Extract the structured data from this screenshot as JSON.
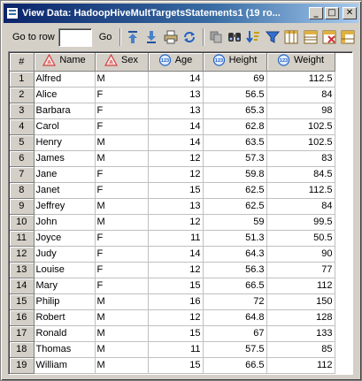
{
  "window": {
    "title": "View Data: HadoopHiveMultTargetsStatements1 (19 ro...",
    "buttons": [
      "_",
      "□",
      "✕"
    ]
  },
  "toolbar": {
    "goto_label": "Go to row",
    "goto_value": "",
    "go_label": "Go",
    "icons": [
      "move-top-icon",
      "move-bottom-icon",
      "print-icon",
      "refresh-icon",
      "copy-icon",
      "find-icon",
      "sort-icon",
      "filter-icon",
      "columns-icon",
      "view-icon",
      "properties-icon",
      "grid-options-icon"
    ]
  },
  "table": {
    "columns": [
      {
        "label": "#",
        "type": "index"
      },
      {
        "label": "Name",
        "type": "char"
      },
      {
        "label": "Sex",
        "type": "char"
      },
      {
        "label": "Age",
        "type": "num"
      },
      {
        "label": "Height",
        "type": "num"
      },
      {
        "label": "Weight",
        "type": "num"
      }
    ],
    "rows": [
      [
        "1",
        "Alfred",
        "M",
        "14",
        "69",
        "112.5"
      ],
      [
        "2",
        "Alice",
        "F",
        "13",
        "56.5",
        "84"
      ],
      [
        "3",
        "Barbara",
        "F",
        "13",
        "65.3",
        "98"
      ],
      [
        "4",
        "Carol",
        "F",
        "14",
        "62.8",
        "102.5"
      ],
      [
        "5",
        "Henry",
        "M",
        "14",
        "63.5",
        "102.5"
      ],
      [
        "6",
        "James",
        "M",
        "12",
        "57.3",
        "83"
      ],
      [
        "7",
        "Jane",
        "F",
        "12",
        "59.8",
        "84.5"
      ],
      [
        "8",
        "Janet",
        "F",
        "15",
        "62.5",
        "112.5"
      ],
      [
        "9",
        "Jeffrey",
        "M",
        "13",
        "62.5",
        "84"
      ],
      [
        "10",
        "John",
        "M",
        "12",
        "59",
        "99.5"
      ],
      [
        "11",
        "Joyce",
        "F",
        "11",
        "51.3",
        "50.5"
      ],
      [
        "12",
        "Judy",
        "F",
        "14",
        "64.3",
        "90"
      ],
      [
        "13",
        "Louise",
        "F",
        "12",
        "56.3",
        "77"
      ],
      [
        "14",
        "Mary",
        "F",
        "15",
        "66.5",
        "112"
      ],
      [
        "15",
        "Philip",
        "M",
        "16",
        "72",
        "150"
      ],
      [
        "16",
        "Robert",
        "M",
        "12",
        "64.8",
        "128"
      ],
      [
        "17",
        "Ronald",
        "M",
        "15",
        "67",
        "133"
      ],
      [
        "18",
        "Thomas",
        "M",
        "11",
        "57.5",
        "85"
      ],
      [
        "19",
        "William",
        "M",
        "15",
        "66.5",
        "112"
      ]
    ]
  },
  "colors": {
    "title_start": "#0a246a",
    "title_end": "#a6caf0",
    "chrome": "#d4d0c8",
    "char_icon": "#d04040",
    "num_icon": "#2060c0"
  }
}
